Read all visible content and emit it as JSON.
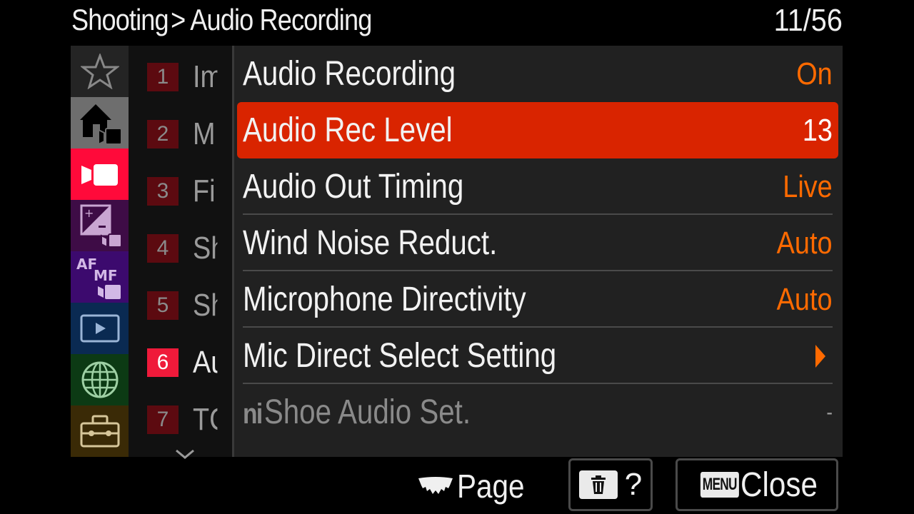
{
  "header": {
    "breadcrumb_parent": "Shooting",
    "breadcrumb_separator": ">",
    "breadcrumb_current": "Audio Recording",
    "page_counter": "11/56"
  },
  "sidebar": {
    "categories": [
      {
        "name": "My Menu",
        "icon": "star-icon",
        "color": "#242424"
      },
      {
        "name": "Main",
        "icon": "home-movie-icon",
        "color": "#6e6e6e"
      },
      {
        "name": "Shooting",
        "icon": "movie-camera-icon",
        "color": "#ff0a3a",
        "active": true
      },
      {
        "name": "Exposure/Color",
        "icon": "exposure-comp-icon",
        "color": "#3e0c46"
      },
      {
        "name": "Focus",
        "icon": "af-mf-icon",
        "color": "#3c0a6e"
      },
      {
        "name": "Playback",
        "icon": "playback-icon",
        "color": "#0a2a52"
      },
      {
        "name": "Network",
        "icon": "globe-icon",
        "color": "#0c3a14"
      },
      {
        "name": "Setup",
        "icon": "toolbox-icon",
        "color": "#3a2a06"
      }
    ]
  },
  "subnav": {
    "items": [
      {
        "number": "1",
        "label": "Im"
      },
      {
        "number": "2",
        "label": "M"
      },
      {
        "number": "3",
        "label": "Fi"
      },
      {
        "number": "4",
        "label": "Sh"
      },
      {
        "number": "5",
        "label": "Sh"
      },
      {
        "number": "6",
        "label": "Au",
        "active": true
      },
      {
        "number": "7",
        "label": "TC"
      }
    ],
    "more_icon": "chevron-down-icon"
  },
  "menu": {
    "items": [
      {
        "label": "Audio Recording",
        "value": "On"
      },
      {
        "label": "Audio Rec Level",
        "value": "13",
        "selected": true
      },
      {
        "label": "Audio Out Timing",
        "value": "Live"
      },
      {
        "label": "Wind Noise Reduct.",
        "value": "Auto"
      },
      {
        "label": "Microphone Directivity",
        "value": "Auto"
      },
      {
        "label": "Mic Direct Select Setting",
        "value": "",
        "submenu": true
      },
      {
        "label": "Shoe Audio Set.",
        "value": "-",
        "disabled": true,
        "prefix_icon": "ni-shoe-icon"
      }
    ]
  },
  "footer": {
    "page_label": "Page",
    "help_label": "?",
    "menu_key": "MENU",
    "close_label": "Close"
  },
  "colors": {
    "accent_value": "#ff6a00",
    "selected_row": "#d92400",
    "active_tab": "#ff0a3a"
  }
}
